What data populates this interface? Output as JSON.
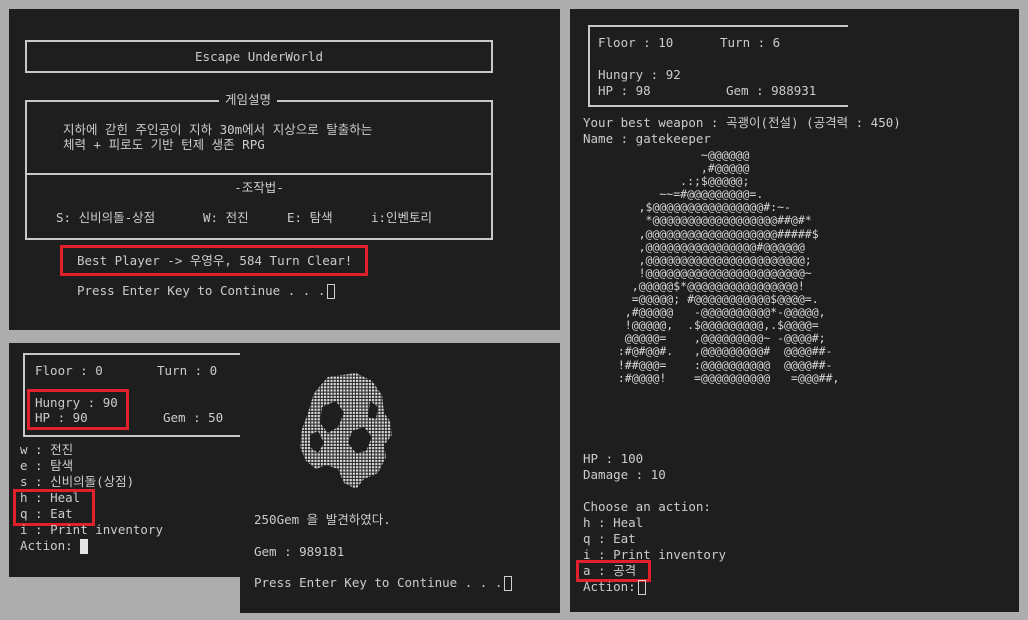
{
  "title_screen": {
    "game_title": "Escape UnderWorld",
    "desc_header": "게임설명",
    "desc_lines": [
      "지하에 갇힌 주인공이 지하 30m에서 지상으로 탈출하는",
      "체력 + 피로도 기반 턴제 생존 RPG"
    ],
    "controls_header": "-조작법-",
    "controls": [
      "S: 신비의돌-상점",
      "W: 전진",
      "E: 탐색",
      "i:인벤토리"
    ],
    "best_player": "Best Player -> 우영우, 584 Turn Clear!",
    "continue_prompt": "Press Enter Key to Continue . . ."
  },
  "status_screen": {
    "floor": "Floor : 0",
    "turn": "Turn : 0",
    "hungry": "Hungry : 90",
    "hp": "HP : 90",
    "gem": "Gem : 50",
    "menu": [
      "w : 전진",
      "e : 탐색",
      "s : 신비의돌(상점)",
      "h : Heal",
      "q : Eat",
      "i : Print inventory"
    ],
    "action_prompt": "Action:"
  },
  "gem_screen": {
    "found": "250Gem 을 발견하였다.",
    "gem": "Gem : 989181",
    "continue_prompt": "Press Enter Key to Continue . . ."
  },
  "battle_screen": {
    "floor": "Floor : 10",
    "turn": "Turn : 6",
    "hungry": "Hungry : 92",
    "hp": "HP : 98",
    "gem": "Gem : 988931",
    "weapon": "Your best weapon : 곡괭이(전설) (공격력 : 450)",
    "enemy_name": "Name : gatekeeper",
    "ascii_art": [
      "              ~@@@@@@",
      "              ,#@@@@@",
      "           .:;$@@@@@;",
      "        ~~=#@@@@@@@@@=.",
      "     ,$@@@@@@@@@@@@@@@@#:~-",
      "      *@@@@@@@@@@@@@@@@@@##@#*",
      "     ,@@@@@@@@@@@@@@@@@@@#####$",
      "     ,@@@@@@@@@@@@@@@@#@@@@@@",
      "     ,@@@@@@@@@@@@@@@@@@@@@@@;",
      "     !@@@@@@@@@@@@@@@@@@@@@@@~",
      "    ,@@@@@$*@@@@@@@@@@@@@@@@!",
      "    =@@@@@; #@@@@@@@@@@@$@@@@=.",
      "   ,#@@@@@   -@@@@@@@@@@*-@@@@@,",
      "   !@@@@@,  .$@@@@@@@@@,.$@@@@=",
      "   @@@@@=    ,@@@@@@@@@~ -@@@@#;",
      "  :#@#@@#.   ,@@@@@@@@@#  @@@@##-",
      "  !##@@@=    :@@@@@@@@@@  @@@@##-",
      "  :#@@@@!    =@@@@@@@@@@   =@@@##,"
    ],
    "enemy_hp": "HP : 100",
    "enemy_damage": "Damage : 10",
    "choose": "Choose an action:",
    "menu": [
      "h : Heal",
      "q : Eat",
      "i : Print inventory",
      "a : 공격"
    ],
    "action_prompt": "Action:"
  }
}
